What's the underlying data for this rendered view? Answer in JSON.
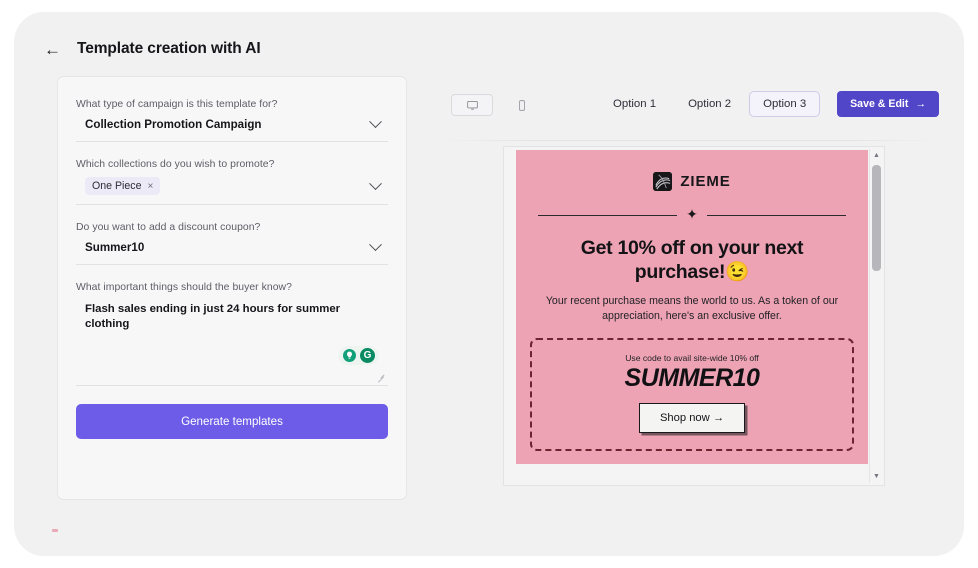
{
  "header": {
    "back_icon": "arrow-left-icon",
    "title": "Template creation with AI"
  },
  "form": {
    "fields": [
      {
        "label": "What type of campaign is this template for?",
        "value": "Collection Promotion Campaign",
        "control": "dropdown"
      },
      {
        "label": "Which collections do you wish to promote?",
        "chip": "One Piece",
        "chip_remove": "×",
        "control": "multiselect"
      },
      {
        "label": "Do you want to add a discount coupon?",
        "value": "Summer10",
        "control": "dropdown"
      },
      {
        "label": "What important things should the buyer know?",
        "value": "Flash sales ending in just 24 hours for summer clothing",
        "control": "textarea"
      }
    ],
    "grammarly": {
      "bulb_icon": "lightbulb-icon",
      "g_icon": "G"
    },
    "generate_button": "Generate templates"
  },
  "toolbar": {
    "devices": [
      {
        "name": "desktop-view-toggle",
        "icon": "monitor-icon",
        "active": true
      },
      {
        "name": "mobile-view-toggle",
        "icon": "phone-icon",
        "active": false
      }
    ],
    "tabs": [
      {
        "label": "Option 1",
        "active": false
      },
      {
        "label": "Option 2",
        "active": false
      },
      {
        "label": "Option 3",
        "active": true
      }
    ],
    "save_label": "Save & Edit",
    "save_arrow": "→"
  },
  "preview": {
    "brand_name": "ZIEME",
    "brand_logo": "zieme-logo-icon",
    "sparkle": "✦",
    "headline": "Get 10% off on your next purchase!😉",
    "subtext": "Your recent purchase means the world to us. As a token of our appreciation, here's an exclusive offer.",
    "coupon_caption": "Use code to avail site-wide 10% off",
    "coupon_code": "SUMMER10",
    "shop_now": "Shop now →",
    "scroll_up": "▲",
    "scroll_down": "▼"
  },
  "colors": {
    "accent_purple": "#6c5ce7",
    "save_purple": "#5246c8",
    "email_pink": "#eda3b4",
    "coupon_border": "#6f2330",
    "grammarly_green": "#0a8a62"
  }
}
